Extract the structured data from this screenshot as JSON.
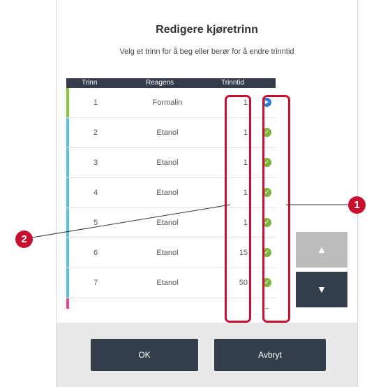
{
  "dialog": {
    "title": "Redigere kjøretrinn",
    "instruction": "Velg et trinn for å beg eller berør for å endre trinntid"
  },
  "table": {
    "headers": {
      "step": "Trinn",
      "reagent": "Reagens",
      "step_time": "Trinntid"
    },
    "rows": [
      {
        "step": "1",
        "reagent": "Formalin",
        "time": "1",
        "status_icon": "play-icon",
        "group_color": "#8cc63f"
      },
      {
        "step": "2",
        "reagent": "Etanol",
        "time": "1",
        "status_icon": "check-icon",
        "group_color": "#5bc4d8"
      },
      {
        "step": "3",
        "reagent": "Etanol",
        "time": "1",
        "status_icon": "check-icon",
        "group_color": "#5bc4d8"
      },
      {
        "step": "4",
        "reagent": "Etanol",
        "time": "1",
        "status_icon": "check-icon",
        "group_color": "#5bc4d8"
      },
      {
        "step": "5",
        "reagent": "Etanol",
        "time": "1",
        "status_icon": "check-icon",
        "group_color": "#5bc4d8"
      },
      {
        "step": "6",
        "reagent": "Etanol",
        "time": "15",
        "status_icon": "check-icon",
        "group_color": "#5bc4d8"
      },
      {
        "step": "7",
        "reagent": "Etanol",
        "time": "50",
        "status_icon": "check-icon",
        "group_color": "#5bc4d8"
      },
      {
        "step": "",
        "reagent": "",
        "time": "",
        "status_icon": "check-icon",
        "group_color": "#e8468c"
      }
    ]
  },
  "scroll": {
    "up_icon": "triangle-up-icon",
    "down_icon": "triangle-down-icon"
  },
  "buttons": {
    "ok": "OK",
    "cancel": "Avbryt"
  },
  "callouts": {
    "status_column": "1",
    "time_column": "2"
  },
  "colors": {
    "header_bg": "#333c48",
    "highlight": "#c8102e",
    "check": "#7bb33d",
    "play": "#2e7fd2",
    "button_bg": "#343e4a",
    "scroll_up_disabled": "#bcbcbc",
    "scroll_down": "#343e4a"
  }
}
